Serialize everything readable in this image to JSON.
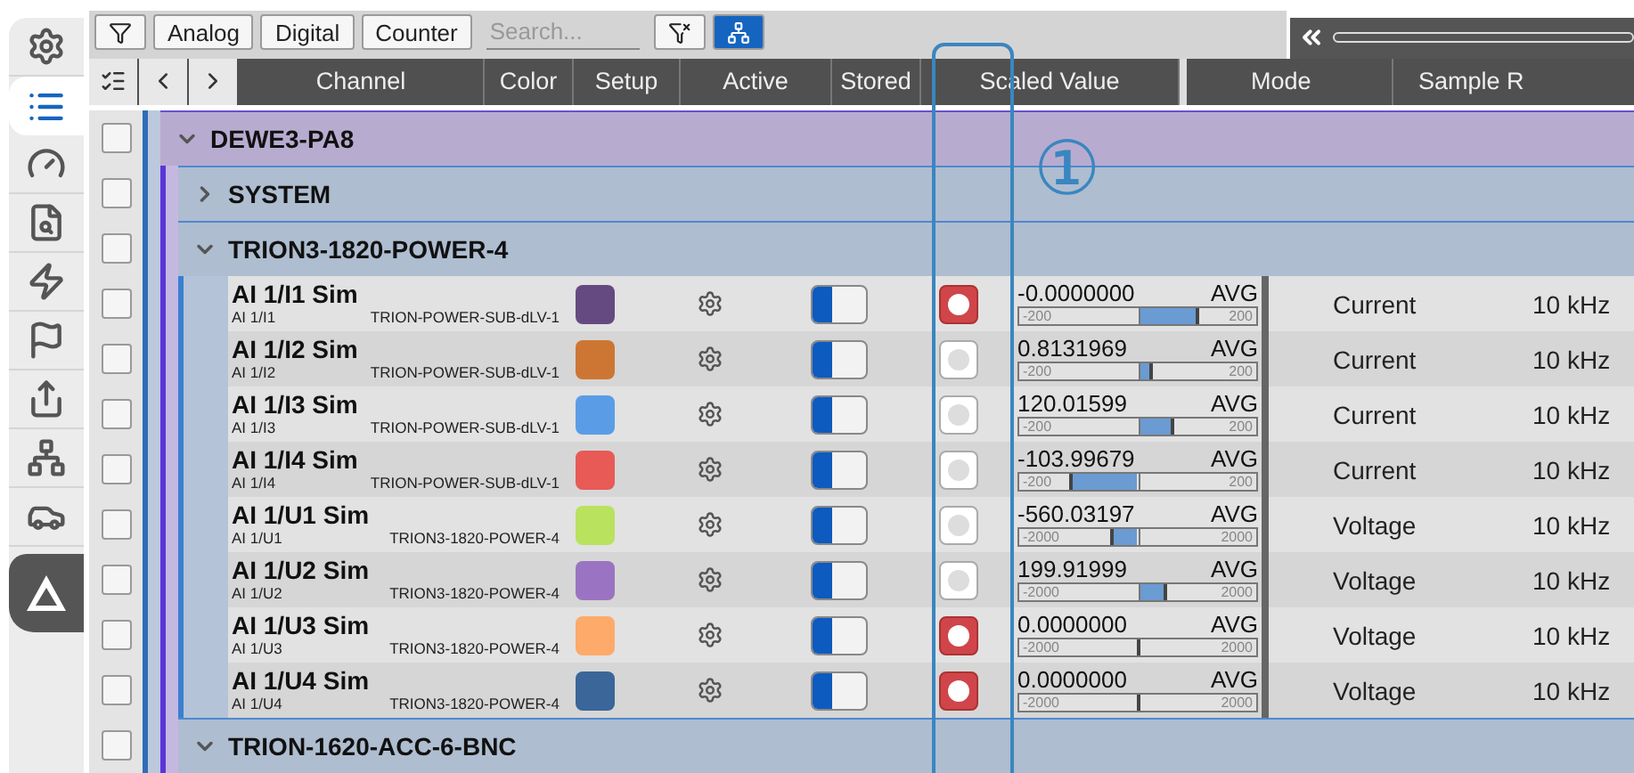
{
  "nav_items": [
    {
      "selected": false
    },
    {
      "selected": true
    },
    {
      "selected": false
    },
    {
      "selected": false
    },
    {
      "selected": false
    },
    {
      "selected": false
    },
    {
      "selected": false
    },
    {
      "selected": false
    },
    {
      "selected": false
    }
  ],
  "toolbar": {
    "filters": [
      {
        "label": "Analog"
      },
      {
        "label": "Digital"
      },
      {
        "label": "Counter"
      }
    ],
    "search": {
      "placeholder": "Search..."
    },
    "tree_view": {
      "selected": true
    }
  },
  "columns": [
    "Channel",
    "Color",
    "Setup",
    "Active",
    "Stored",
    "Scaled Value",
    "Mode",
    "Sample R"
  ],
  "tree": [
    {
      "name": "DEWE3-PA8",
      "expanded": true,
      "checked": false,
      "children": [
        {
          "name": "SYSTEM",
          "expanded": false,
          "checked": false
        },
        {
          "name": "TRION3-1820-POWER-4",
          "expanded": true,
          "checked": false,
          "channels": [
            {
              "name": "AI 1/I1 Sim",
              "short": "AI 1/I1",
              "module": "TRION-POWER-SUB-dLV-1",
              "color": "#654a82",
              "checked": false,
              "on": true,
              "stored": true,
              "value": "-0.0000000",
              "mode_tag": "AVG",
              "min": "-200",
              "max": "200",
              "level": 0.75,
              "mode": "Current",
              "rate": "10 kHz"
            },
            {
              "name": "AI 1/I2 Sim",
              "short": "AI 1/I2",
              "module": "TRION-POWER-SUB-dLV-1",
              "color": "#cd7634",
              "checked": false,
              "on": true,
              "stored": false,
              "value": "0.8131969",
              "mode_tag": "AVG",
              "min": "-200",
              "max": "200",
              "level": 0.56,
              "mode": "Current",
              "rate": "10 kHz"
            },
            {
              "name": "AI 1/I3 Sim",
              "short": "AI 1/I3",
              "module": "TRION-POWER-SUB-dLV-1",
              "color": "#5a9de6",
              "checked": false,
              "on": true,
              "stored": false,
              "value": "120.01599",
              "mode_tag": "AVG",
              "min": "-200",
              "max": "200",
              "level": 0.65,
              "mode": "Current",
              "rate": "10 kHz"
            },
            {
              "name": "AI 1/I4 Sim",
              "short": "AI 1/I4",
              "module": "TRION-POWER-SUB-dLV-1",
              "color": "#e85a55",
              "checked": false,
              "on": true,
              "stored": false,
              "value": "-103.99679",
              "mode_tag": "AVG",
              "min": "-200",
              "max": "200",
              "level": 0.22,
              "mode": "Current",
              "rate": "10 kHz"
            },
            {
              "name": "AI 1/U1 Sim",
              "short": "AI 1/U1",
              "module": "TRION3-1820-POWER-4",
              "color": "#b9e25e",
              "checked": false,
              "on": true,
              "stored": false,
              "value": "-560.03197",
              "mode_tag": "AVG",
              "min": "-2000",
              "max": "2000",
              "level": 0.39,
              "mode": "Voltage",
              "rate": "10 kHz"
            },
            {
              "name": "AI 1/U2 Sim",
              "short": "AI 1/U2",
              "module": "TRION3-1820-POWER-4",
              "color": "#9a74c2",
              "checked": false,
              "on": true,
              "stored": false,
              "value": "199.91999",
              "mode_tag": "AVG",
              "min": "-2000",
              "max": "2000",
              "level": 0.62,
              "mode": "Voltage",
              "rate": "10 kHz"
            },
            {
              "name": "AI 1/U3 Sim",
              "short": "AI 1/U3",
              "module": "TRION3-1820-POWER-4",
              "color": "#fdaa6a",
              "checked": false,
              "on": true,
              "stored": true,
              "value": "0.0000000",
              "mode_tag": "AVG",
              "min": "-2000",
              "max": "2000",
              "level": 0.5,
              "mode": "Voltage",
              "rate": "10 kHz"
            },
            {
              "name": "AI 1/U4 Sim",
              "short": "AI 1/U4",
              "module": "TRION3-1820-POWER-4",
              "color": "#3a6699",
              "checked": false,
              "on": true,
              "stored": true,
              "value": "0.0000000",
              "mode_tag": "AVG",
              "min": "-2000",
              "max": "2000",
              "level": 0.5,
              "mode": "Voltage",
              "rate": "10 kHz"
            }
          ]
        },
        {
          "name": "TRION-1620-ACC-6-BNC",
          "expanded": true,
          "checked": false
        }
      ]
    }
  ],
  "annotation": {
    "label": "①"
  }
}
